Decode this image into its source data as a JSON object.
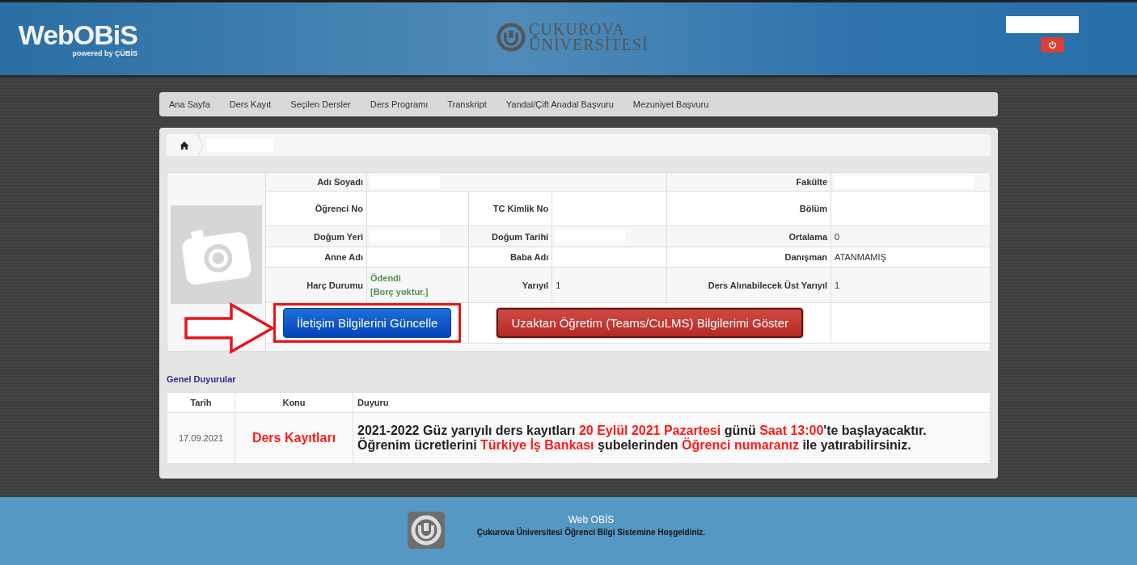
{
  "header": {
    "logo": "WebOBiS",
    "logo_tagline": "powered by ÇÜBİS",
    "university_line_1": "ÇUKUROVA",
    "university_line_2": "ÜNİVERSİTESİ"
  },
  "nav": [
    {
      "label": "Ana Sayfa"
    },
    {
      "label": "Ders Kayıt"
    },
    {
      "label": "Seçilen Dersler"
    },
    {
      "label": "Ders Programı"
    },
    {
      "label": "Transkript"
    },
    {
      "label": "Yandal/Çift Anadal Başvuru"
    },
    {
      "label": "Mezuniyet Başvuru"
    }
  ],
  "info_rows": [
    {
      "cells": [
        {
          "label": "Adı Soyadı",
          "redacted": true
        },
        {
          "label": "Fakülte",
          "redacted": true
        }
      ]
    },
    {
      "cells": [
        {
          "label": "Öğrenci No"
        },
        {
          "label": "TC Kimlik No"
        },
        {
          "label": "Bölüm"
        }
      ]
    },
    {
      "cells": [
        {
          "label": "Doğum Yeri",
          "redacted": true
        },
        {
          "label": "Doğum Tarihi",
          "redacted": true
        },
        {
          "label": "Ortalama",
          "value": "0"
        }
      ]
    },
    {
      "cells": [
        {
          "label": "Anne Adı"
        },
        {
          "label": "Baba Adı"
        },
        {
          "label": "Danışman",
          "value": "ATANMAMIŞ"
        }
      ]
    },
    {
      "cells": [
        {
          "label": "Harç Durumu",
          "value": "Ödendi",
          "value_2": "[Borç yoktur.]",
          "kind": "status"
        },
        {
          "label": "Yarıyıl",
          "value": "1"
        },
        {
          "label": "Ders Alınabilecek Üst Yarıyıl",
          "value": "1"
        }
      ]
    }
  ],
  "buttons": [
    {
      "label": "İletişim Bilgilerini Güncelle",
      "kind": "primary",
      "highlighted": true
    },
    {
      "label": "Uzaktan Öğretim (Teams/CuLMS) Bilgilerimi Göster",
      "kind": "danger",
      "highlighted": false
    }
  ],
  "announcements": {
    "title": "Genel Duyurular",
    "columns": [
      "Tarih",
      "Konu",
      "Duyuru"
    ],
    "rows": [
      {
        "date": "17.09.2021",
        "subject": "Ders Kayıtları",
        "lines": [
          [
            {
              "text": "2021-2022 Güz yarıyılı ders kayıtları ",
              "highlight": false
            },
            {
              "text": "20 Eylül 2021 Pazartesi",
              "highlight": true
            },
            {
              "text": " günü ",
              "highlight": false
            },
            {
              "text": "Saat 13:00",
              "highlight": true
            },
            {
              "text": "'te başlayacaktır.",
              "highlight": false
            }
          ],
          [
            {
              "text": "Öğrenim ücretlerini ",
              "highlight": false
            },
            {
              "text": "Türkiye İş Bankası",
              "highlight": true
            },
            {
              "text": " şubelerinden ",
              "highlight": false
            },
            {
              "text": "Öğrenci numaranız",
              "highlight": true
            },
            {
              "text": " ile yatırabilirsiniz.",
              "highlight": false
            }
          ]
        ]
      }
    ]
  },
  "footer": {
    "title": "Web OBİS",
    "subtitle": "Çukurova Üniversitesi Öğrenci Bilgi Sistemine Hoşgeldiniz."
  }
}
